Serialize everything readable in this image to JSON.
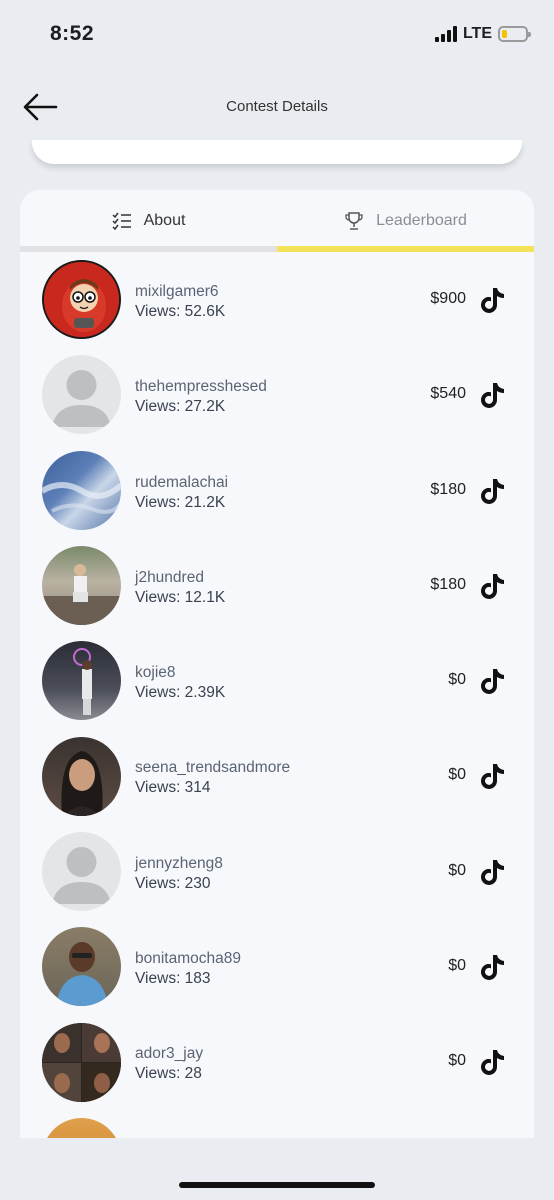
{
  "status_bar": {
    "time": "8:52",
    "network": "LTE",
    "battery_color": "#f2c200"
  },
  "nav": {
    "title": "Contest Details",
    "back_icon": "arrow-left-icon"
  },
  "tabs": [
    {
      "label": "About",
      "icon": "checklist-icon",
      "active": false
    },
    {
      "label": "Leaderboard",
      "icon": "trophy-icon",
      "active": true
    }
  ],
  "accent_color": "#f3e25a",
  "leaderboard": [
    {
      "username": "mixilgamer6",
      "views": "Views: 52.6K",
      "amount": "$900",
      "avatar": "cartoon-avatar"
    },
    {
      "username": "thehempresshesed",
      "views": "Views: 27.2K",
      "amount": "$540",
      "avatar": "placeholder-avatar"
    },
    {
      "username": "rudemalachai",
      "views": "Views: 21.2K",
      "amount": "$180",
      "avatar": "sky-avatar"
    },
    {
      "username": "j2hundred",
      "views": "Views: 12.1K",
      "amount": "$180",
      "avatar": "photo-avatar"
    },
    {
      "username": "kojie8",
      "views": "Views: 2.39K",
      "amount": "$0",
      "avatar": "photo-avatar"
    },
    {
      "username": "seena_trendsandmore",
      "views": "Views: 314",
      "amount": "$0",
      "avatar": "photo-avatar"
    },
    {
      "username": "jennyzheng8",
      "views": "Views: 230",
      "amount": "$0",
      "avatar": "placeholder-avatar"
    },
    {
      "username": "bonitamocha89",
      "views": "Views: 183",
      "amount": "$0",
      "avatar": "photo-avatar"
    },
    {
      "username": "ador3_jay",
      "views": "Views: 28",
      "amount": "$0",
      "avatar": "photo-avatar"
    }
  ]
}
